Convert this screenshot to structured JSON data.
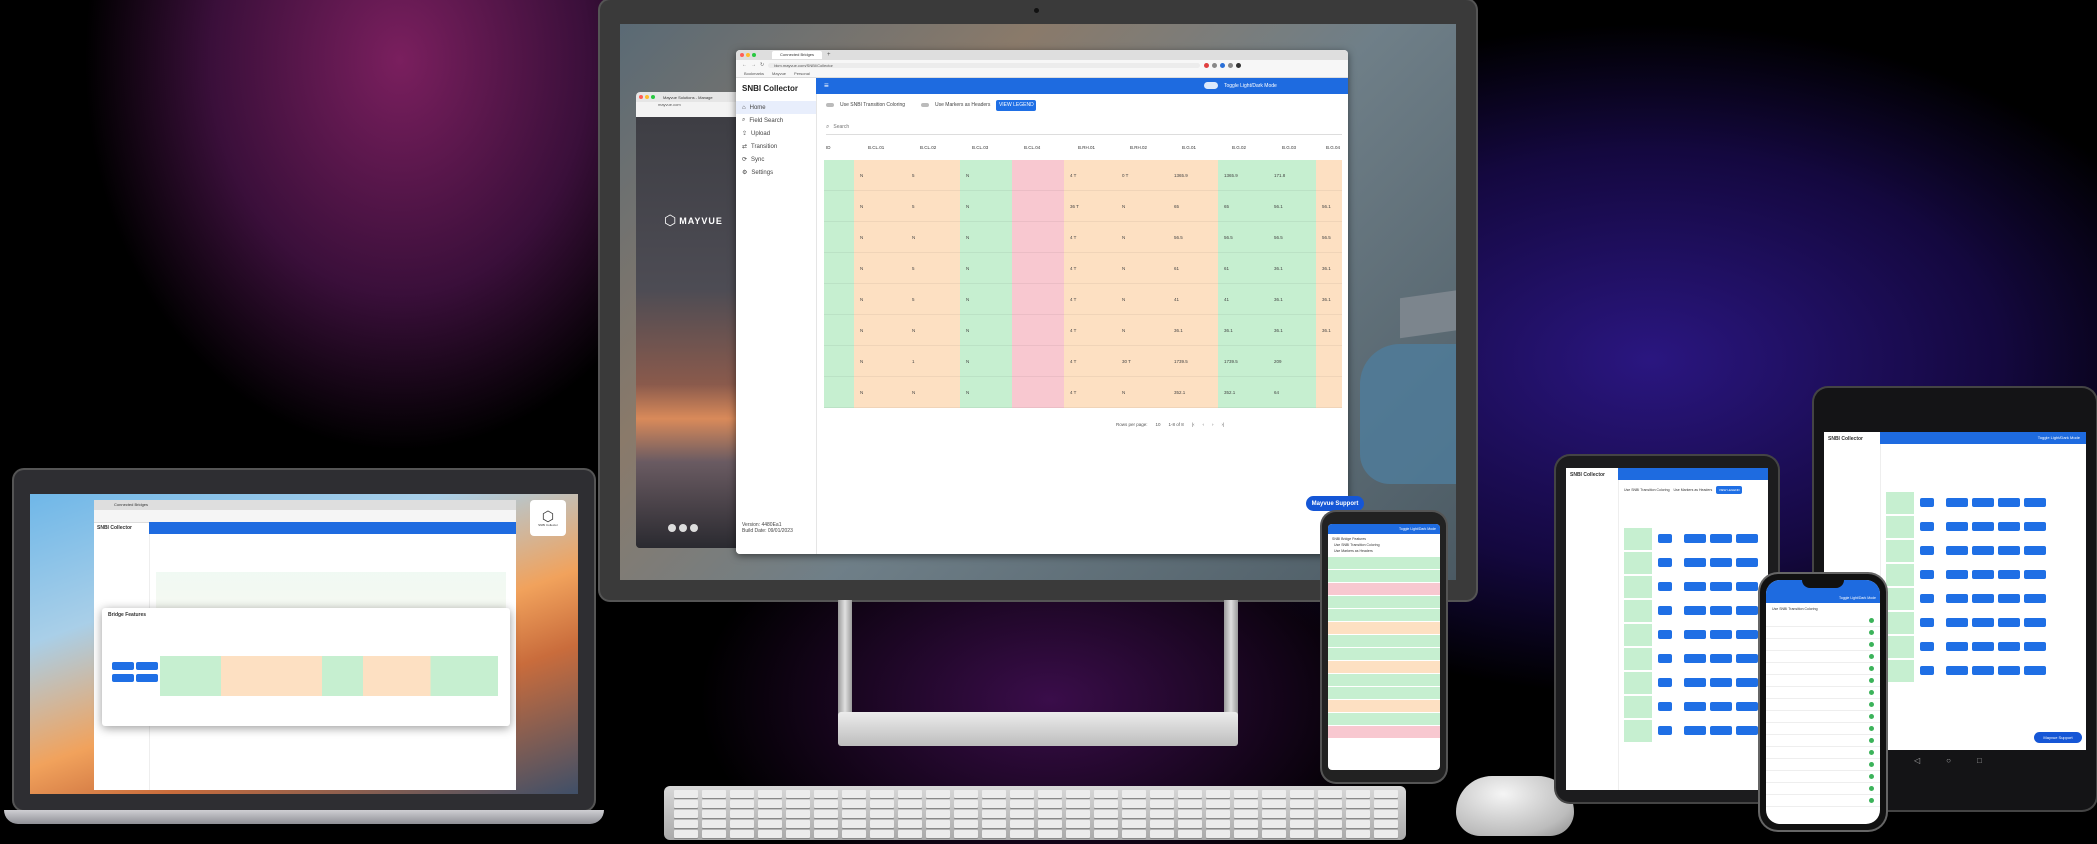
{
  "brand": {
    "logo_text": "MAYVUE"
  },
  "browser": {
    "front_tab": "Connected Bridges",
    "front_url": "bkm.mayvue.com/SNBI/Collector",
    "bookmarks": [
      "Bookmarks",
      "Mayvue",
      "Personal"
    ],
    "back_tab": "Mayvue Solutions - Manage",
    "back_url": "mayvue.com"
  },
  "app": {
    "title": "SNBI Collector",
    "toggle_label": "Toggle Light/Dark Mode",
    "nav": [
      "Home",
      "Field Search",
      "Upload",
      "Transition",
      "Sync",
      "Settings"
    ],
    "version": "Version: 4480Ea1",
    "build_date": "Build Date: 09/01/2023",
    "toolbar": {
      "transition_coloring": "Use SNBI Transition Coloring",
      "markers_toggle": "Use Markers as Headers",
      "view_legend": "VIEW LEGEND"
    },
    "search_placeholder": "Search",
    "columns": [
      "ID",
      "B.CL.01",
      "B.CL.02",
      "B.CL.03",
      "B.CL.04",
      "B.RH.01",
      "B.RH.02",
      "B.G.01",
      "B.G.02",
      "B.G.03",
      "B.G.04"
    ],
    "rows": [
      [
        "",
        "N",
        "5",
        "N",
        "",
        "4 T",
        "0 T",
        "1365.9",
        "1365.9",
        "171.8",
        ""
      ],
      [
        "",
        "N",
        "5",
        "N",
        "",
        "36 T",
        "N",
        "65",
        "65",
        "56.1",
        "56.1"
      ],
      [
        "",
        "N",
        "N",
        "N",
        "",
        "4 T",
        "N",
        "56.5",
        "56.5",
        "56.5",
        "56.5"
      ],
      [
        "",
        "N",
        "5",
        "N",
        "",
        "4 T",
        "N",
        "61",
        "61",
        "36.1",
        "36.1"
      ],
      [
        "",
        "N",
        "5",
        "N",
        "",
        "4 T",
        "N",
        "41",
        "41",
        "36.1",
        "36.1"
      ],
      [
        "",
        "N",
        "N",
        "N",
        "",
        "4 T",
        "N",
        "36.1",
        "36.1",
        "36.1",
        "36.1"
      ],
      [
        "",
        "N",
        "1",
        "N",
        "",
        "4 T",
        "30 T",
        "1739.5",
        "1739.5",
        "209",
        ""
      ],
      [
        "",
        "N",
        "N",
        "N",
        "",
        "4 T",
        "N",
        "352.1",
        "352.1",
        "64",
        ""
      ]
    ],
    "pagination": {
      "rows_per_page_label": "Rows per page:",
      "rows_per_page": "10",
      "range": "1-8 of 8"
    },
    "support_button": "Mayvue Support"
  },
  "laptop": {
    "dialog_title": "Bridge Features",
    "back_tab": "Connected Bridges",
    "logo_caption": "SNBI Collector"
  },
  "phone": {
    "toggle_label": "Toggle Light/Dark Mode",
    "section": "SNBI Bridge Features",
    "option1": "Use SNBI Transition Coloring",
    "option2": "Use Markers as Headers"
  },
  "colors": {
    "app_blue": "#1e6be0",
    "cell_green": "#c6efd0",
    "cell_orange": "#fde0c2",
    "cell_red": "#f8c8d0",
    "support_blue": "#1556d6"
  }
}
